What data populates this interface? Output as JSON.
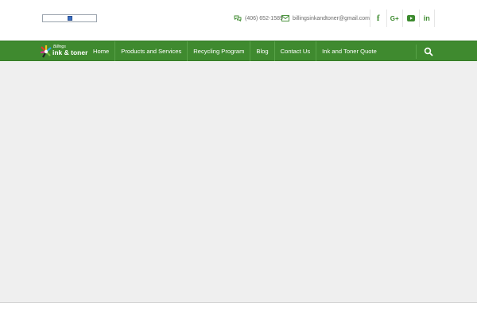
{
  "header": {
    "phone": "(406) 652-1589",
    "email": "billingsinkandtoner@gmail.com",
    "social": [
      {
        "name": "facebook-icon",
        "glyph": "f"
      },
      {
        "name": "google-plus-icon",
        "glyph": "G+"
      },
      {
        "name": "youtube-icon",
        "glyph": ""
      },
      {
        "name": "linkedin-icon",
        "glyph": "in"
      }
    ]
  },
  "logo": {
    "top": "Billings",
    "main": "ink & toner"
  },
  "nav": {
    "items": [
      "Home",
      "Products and Services",
      "Recycling Program",
      "Blog",
      "Contact Us",
      "Ink and Toner Quote"
    ]
  },
  "colors": {
    "brand_green": "#3f8a2f",
    "content_bg": "#efefef"
  }
}
